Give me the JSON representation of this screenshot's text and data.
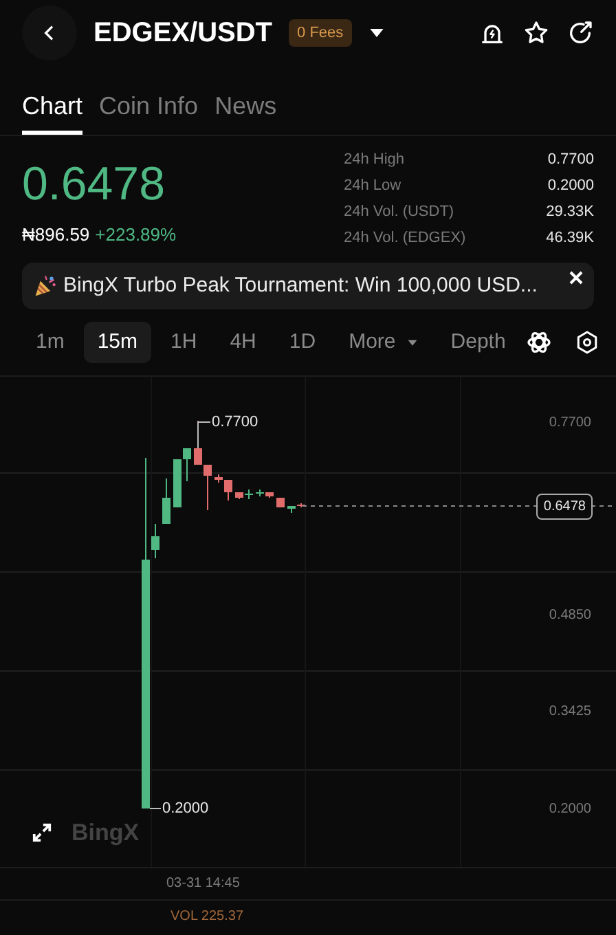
{
  "header": {
    "pair": "EDGEX/USDT",
    "fee_badge": "0 Fees"
  },
  "tabs": [
    {
      "label": "Chart",
      "selected": true
    },
    {
      "label": "Coin Info",
      "selected": false
    },
    {
      "label": "News",
      "selected": false
    }
  ],
  "price": {
    "last": "0.6478",
    "fiat": "₦896.59",
    "change": "+223.89%"
  },
  "stats": [
    {
      "label": "24h High",
      "value": "0.7700"
    },
    {
      "label": "24h Low",
      "value": "0.2000"
    },
    {
      "label": "24h Vol. (USDT)",
      "value": "29.33K"
    },
    {
      "label": "24h Vol. (EDGEX)",
      "value": "46.39K"
    }
  ],
  "banner": {
    "text": "BingX Turbo Peak Tournament: Win 100,000 USD..."
  },
  "intervals": [
    {
      "label": "1m",
      "selected": false
    },
    {
      "label": "15m",
      "selected": true
    },
    {
      "label": "1H",
      "selected": false
    },
    {
      "label": "4H",
      "selected": false
    },
    {
      "label": "1D",
      "selected": false
    }
  ],
  "more": "More",
  "depth": "Depth",
  "chart": {
    "high_marker": "0.7700",
    "low_marker": "0.2000",
    "y_ticks": [
      "0.7700",
      "0.4850",
      "0.3425",
      "0.2000"
    ],
    "last_price_tag": "0.6478",
    "watermark": "BingX",
    "time_label": "03-31 14:45",
    "volume": "VOL 225.37"
  }
}
